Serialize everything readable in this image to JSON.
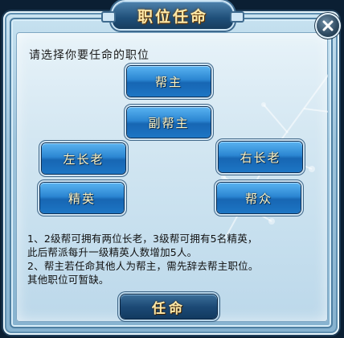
{
  "dialog": {
    "title": "职位任命",
    "close_icon": "close-icon",
    "prompt": "请选择你要任命的职位",
    "positions": {
      "leader": "帮主",
      "vice_leader": "副帮主",
      "left_elder": "左长老",
      "right_elder": "右长老",
      "elite": "精英",
      "member": "帮众"
    },
    "notes": {
      "line1": "1、2级帮可拥有两位长老，3级帮可拥有5名精英，",
      "line2": "此后帮派每升一级精英人数增加5人。",
      "line3": "2、帮主若任命其他人为帮主，需先辞去帮主职位。",
      "line4": "其他职位可暂缺。"
    },
    "appoint_label": "任命"
  },
  "colors": {
    "button_blue": "#2b86d2",
    "button_text": "#fff4c2",
    "title_gold": "#ffe9a8",
    "panel_bg": "#d4e7f2"
  }
}
